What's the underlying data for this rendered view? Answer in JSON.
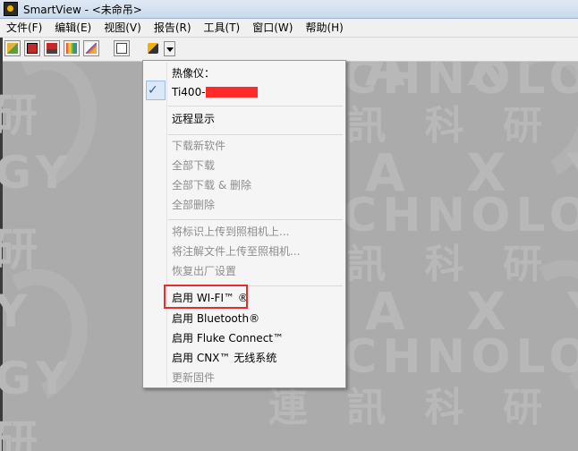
{
  "window": {
    "title": "SmartView - <未命吊>"
  },
  "menubar": {
    "items": [
      "文件(F)",
      "编辑(E)",
      "视图(V)",
      "报告(R)",
      "工具(T)",
      "窗口(W)",
      "帮助(H)"
    ]
  },
  "toolbar": {
    "buttons": [
      "open-icon",
      "save-icon",
      "print-icon",
      "palette-icon",
      "edit-icon",
      "page-icon",
      "camera-icon"
    ]
  },
  "watermark": {
    "tech": "TECHNOLOGY",
    "cn": "連 訊 科 研",
    "brand": "F A X Y"
  },
  "menu": {
    "header": "热像仪：",
    "device": "Ti400-",
    "remote": "远程显示",
    "download_firmware": "下载新软件",
    "download_all": "全部下载",
    "download_all_delete": "全部下载 & 删除",
    "delete_all": "全部删除",
    "upload_marks": "将标识上传到照相机上...",
    "upload_annotations": "将注解文件上传至照相机...",
    "factory_reset": "恢复出厂设置",
    "enable_wifi": "启用 WI-FI™ ®",
    "enable_bluetooth": "启用 Bluetooth®",
    "enable_fluke_connect": "启用 Fluke Connect™",
    "enable_cnx": "启用 CNX™ 无线系统",
    "update_firmware": "更新固件"
  },
  "colors": {
    "highlight_box": "#e03030",
    "redaction": "#ff2a2a",
    "checkmark": "#2a5aa8"
  }
}
